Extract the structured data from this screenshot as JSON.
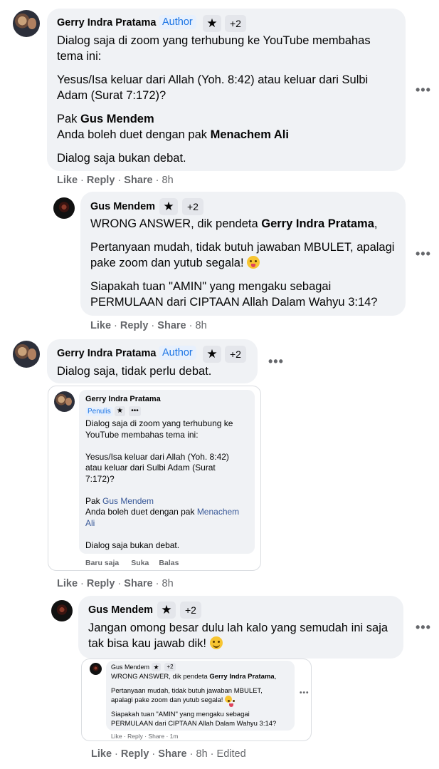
{
  "labels": {
    "author": "Author",
    "plus2": "+2",
    "like": "Like",
    "reply": "Reply",
    "share": "Share",
    "sep": " · ",
    "edited": "Edited"
  },
  "comments": [
    {
      "name": "Gerry Indra Pratama",
      "lines": [
        "Dialog saja di zoom yang terhubung ke YouTube membahas tema ini:",
        "Yesus/Isa keluar dari Allah (Yoh. 8:42) atau keluar dari Sulbi Adam (Surat 7:172)?"
      ],
      "para3_prefix": "Pak ",
      "para3_bold": "Gus Mendem",
      "para4_prefix": "Anda boleh duet dengan pak ",
      "para4_bold": "Menachem Ali",
      "para5": "Dialog saja bukan debat.",
      "time": "8h"
    },
    {
      "name": "Gus Mendem",
      "para1_prefix": "WRONG ANSWER, dik pendeta ",
      "para1_bold": "Gerry Indra Pratama",
      "para1_suffix": ",",
      "para2": "Pertanyaan mudah, tidak butuh jawaban MBULET, apalagi pake zoom dan yutub segala! ",
      "para3": "Siapakah tuan \"AMIN\" yang mengaku sebagai PERMULAAN dari CIPTAAN Allah Dalam Wahyu 3:14?",
      "time": "8h"
    },
    {
      "name": "Gerry Indra Pratama",
      "text": "Dialog saja, tidak perlu debat.",
      "time": "8h"
    },
    {
      "name": "Gus Mendem",
      "text": "Jangan omong besar dulu lah kalo yang semudah ini saja tak bisa kau jawab dik! ",
      "time": "8h"
    }
  ],
  "embed1": {
    "name": "Gerry Indra Pratama",
    "badge": "Penulis",
    "more": "•••",
    "l1": "Dialog saja di zoom yang terhubung ke",
    "l2": "YouTube membahas tema ini:",
    "l3": "Yesus/Isa keluar dari Allah (Yoh. 8:42)",
    "l4": "atau keluar dari Sulbi Adam (Surat",
    "l5": "7:172)?",
    "l6a": "Pak ",
    "l6b": "Gus Mendem",
    "l7a": "Anda boleh duet dengan pak ",
    "l7b": "Menachem",
    "l8": "Ali",
    "l9": "Dialog saja bukan debat.",
    "a1": "Baru saja",
    "a2": "Suka",
    "a3": "Balas"
  },
  "embed2": {
    "name": "Gus Mendem",
    "plus": "+2",
    "p1a": "WRONG ANSWER, dik pendeta ",
    "p1b": "Gerry Indra Pratama",
    "p1c": ",",
    "p2a": "Pertanyaan mudah, tidak butuh jawaban MBULET,",
    "p2b": "apalagi pake zoom dan yutub segala! ",
    "p3a": "Siapakah tuan \"AMIN\" yang mengaku sebagai",
    "p3b": "PERMULAAN dari CIPTAAN Allah Dalam Wahyu 3:14?",
    "actions": "Like · Reply · Share · 1m"
  }
}
